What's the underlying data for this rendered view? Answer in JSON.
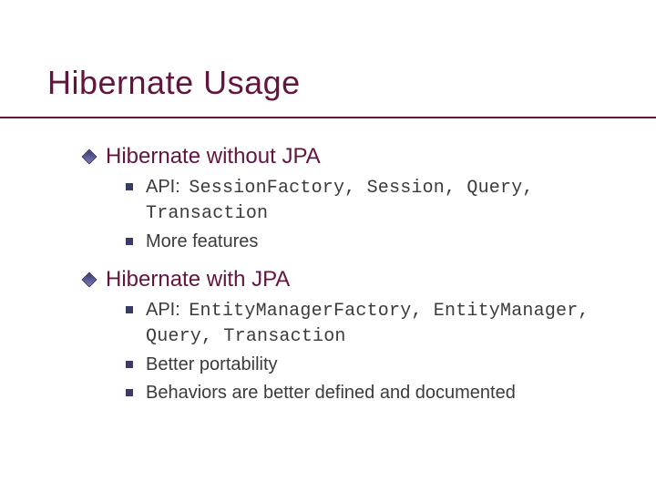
{
  "title": "Hibernate Usage",
  "sections": [
    {
      "heading": "Hibernate without JPA",
      "subitems": [
        {
          "prefix": "API: ",
          "code": "SessionFactory, Session, Query, Transaction"
        },
        {
          "text": "More features"
        }
      ]
    },
    {
      "heading": "Hibernate with JPA",
      "subitems": [
        {
          "prefix": "API: ",
          "code": "EntityManagerFactory, EntityManager, Query, Transaction"
        },
        {
          "text": "Better portability"
        },
        {
          "text": "Behaviors are better defined and documented"
        }
      ]
    }
  ]
}
